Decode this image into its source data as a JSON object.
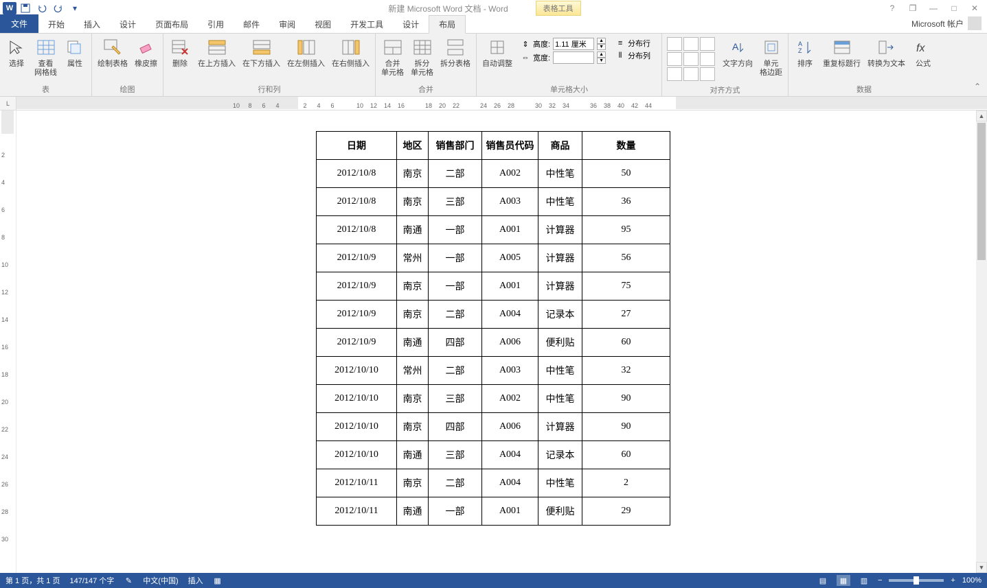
{
  "title": {
    "doc": "新建 Microsoft Word 文档 - Word",
    "context": "表格工具"
  },
  "window_buttons": {
    "help": "?",
    "restore": "❐",
    "min": "—",
    "max": "□",
    "close": "✕"
  },
  "tabs": {
    "file": "文件",
    "home": "开始",
    "insert": "插入",
    "design": "设计",
    "layout": "页面布局",
    "ref": "引用",
    "mail": "邮件",
    "review": "审阅",
    "view": "视图",
    "dev": "开发工具",
    "ctx_design": "设计",
    "ctx_layout": "布局",
    "account": "Microsoft 帐户"
  },
  "ribbon": {
    "groups": {
      "table": "表",
      "draw": "绘图",
      "rowscols": "行和列",
      "merge": "合并",
      "cellsize": "单元格大小",
      "align": "对齐方式",
      "data": "数据"
    },
    "table": {
      "select": "选择",
      "gridlines": "查看\n网格线",
      "props": "属性"
    },
    "draw": {
      "draw": "绘制表格",
      "eraser": "橡皮擦"
    },
    "rowscols": {
      "delete": "删除",
      "above": "在上方插入",
      "below": "在下方插入",
      "left": "在左侧插入",
      "right": "在右侧插入"
    },
    "merge": {
      "merge": "合并\n单元格",
      "split": "拆分\n单元格",
      "splittbl": "拆分表格"
    },
    "fit": {
      "autofit": "自动调整"
    },
    "size": {
      "height_lbl": "高度:",
      "height_val": "1.11 厘米",
      "width_lbl": "宽度:",
      "width_val": "",
      "distrow": "分布行",
      "distcol": "分布列"
    },
    "align": {
      "textdir": "文字方向",
      "margins": "单元\n格边距"
    },
    "data": {
      "sort": "排序",
      "repeathdr": "重复标题行",
      "convert": "转换为文本",
      "formula": "公式"
    }
  },
  "ruler": {
    "marks": [
      "10",
      "8",
      "6",
      "4",
      "",
      "2",
      "4",
      "6",
      "",
      "10",
      "12",
      "14",
      "16",
      "",
      "18",
      "20",
      "22",
      "",
      "24",
      "26",
      "28",
      "",
      "30",
      "32",
      "34",
      "",
      "36",
      "38",
      "40",
      "42",
      "44"
    ]
  },
  "vruler": {
    "marks": [
      "",
      "2",
      "",
      "4",
      "",
      "6",
      "",
      "8",
      "",
      "10",
      "",
      "12",
      "",
      "14",
      "",
      "16",
      "",
      "18",
      "",
      "20",
      "",
      "22",
      "",
      "24",
      "",
      "26",
      "",
      "28",
      "",
      "30"
    ]
  },
  "table": {
    "headers": [
      "日期",
      "地区",
      "销售部门",
      "销售员代码",
      "商品",
      "数量"
    ],
    "rows": [
      [
        "2012/10/8",
        "南京",
        "二部",
        "A002",
        "中性笔",
        "50"
      ],
      [
        "2012/10/8",
        "南京",
        "三部",
        "A003",
        "中性笔",
        "36"
      ],
      [
        "2012/10/8",
        "南通",
        "一部",
        "A001",
        "计算器",
        "95"
      ],
      [
        "2012/10/9",
        "常州",
        "一部",
        "A005",
        "计算器",
        "56"
      ],
      [
        "2012/10/9",
        "南京",
        "一部",
        "A001",
        "计算器",
        "75"
      ],
      [
        "2012/10/9",
        "南京",
        "二部",
        "A004",
        "记录本",
        "27"
      ],
      [
        "2012/10/9",
        "南通",
        "四部",
        "A006",
        "便利贴",
        "60"
      ],
      [
        "2012/10/10",
        "常州",
        "二部",
        "A003",
        "中性笔",
        "32"
      ],
      [
        "2012/10/10",
        "南京",
        "三部",
        "A002",
        "中性笔",
        "90"
      ],
      [
        "2012/10/10",
        "南京",
        "四部",
        "A006",
        "计算器",
        "90"
      ],
      [
        "2012/10/10",
        "南通",
        "三部",
        "A004",
        "记录本",
        "60"
      ],
      [
        "2012/10/11",
        "南京",
        "二部",
        "A004",
        "中性笔",
        "2"
      ],
      [
        "2012/10/11",
        "南通",
        "一部",
        "A001",
        "便利贴",
        "29"
      ]
    ]
  },
  "status": {
    "page": "第 1 页，共 1 页",
    "words": "147/147 个字",
    "lang": "中文(中国)",
    "mode": "插入",
    "zoom": "100%",
    "minus": "−",
    "plus": "+"
  }
}
